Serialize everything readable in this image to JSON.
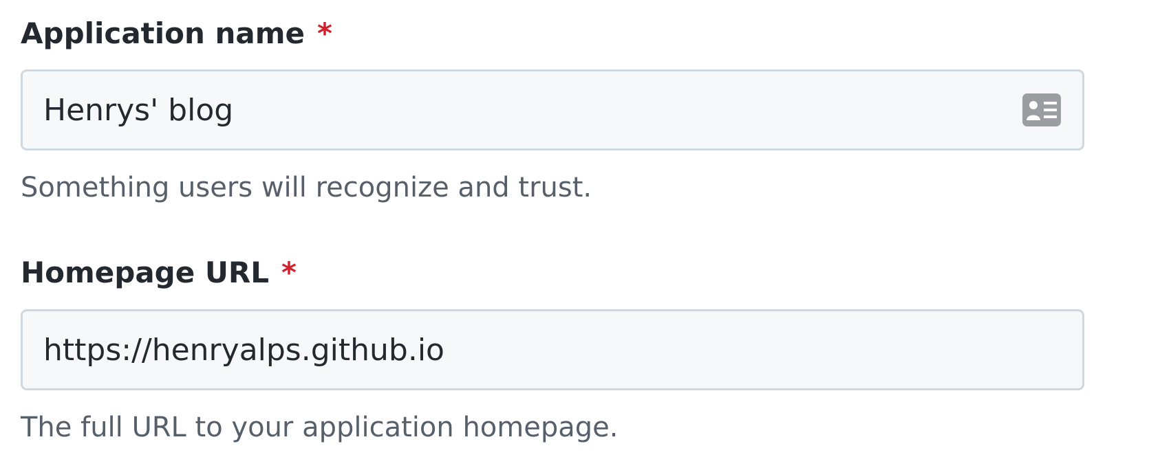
{
  "fields": [
    {
      "label": "Application name",
      "required_marker": "*",
      "value": "Henrys' blog",
      "note": "Something users will recognize and trust.",
      "icon": "contact-card-icon"
    },
    {
      "label": "Homepage URL",
      "required_marker": "*",
      "value": "https://henryalps.github.io",
      "note": "The full URL to your application homepage."
    }
  ],
  "colors": {
    "required": "#cf222e",
    "input_background": "#f6f8fa",
    "input_border": "#d0d7de",
    "note_text": "#57606a",
    "label_text": "#24292f"
  }
}
